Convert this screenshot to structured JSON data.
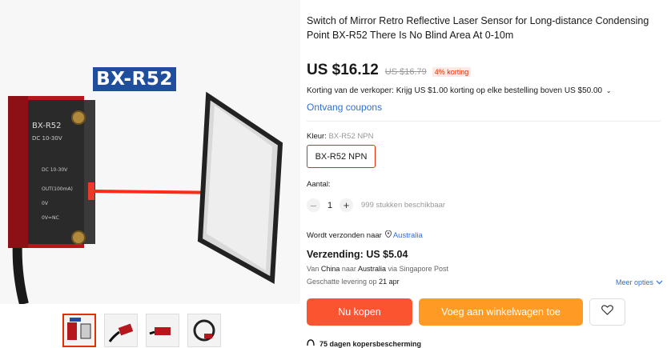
{
  "gallery": {
    "model_badge": "BX-R52",
    "sensor_label_lines": [
      "BX-R52",
      "DC 10-30V",
      "DC 10-30V",
      "OUT(100mA)",
      "0V",
      "0V=NC"
    ],
    "thumbnails": [
      {
        "name": "thumb-1",
        "active": true
      },
      {
        "name": "thumb-2",
        "active": false
      },
      {
        "name": "thumb-3",
        "active": false
      },
      {
        "name": "thumb-4",
        "active": false
      }
    ]
  },
  "product": {
    "title": "Switch of Mirror Retro Reflective Laser Sensor for Long-distance Condensing Point BX-R52 There Is No Blind Area At 0-10m",
    "price": "US $16.12",
    "original_price": "US $16.79",
    "discount": "4% korting",
    "seller_discount": "Korting van de verkoper: Krijg US $1.00 korting op elke bestelling boven US $50.00",
    "coupons": "Ontvang coupons"
  },
  "variant": {
    "color_label": "Kleur:",
    "color_value": "BX-R52 NPN",
    "selected": "BX-R52 NPN"
  },
  "quantity": {
    "label": "Aantal:",
    "minus": "–",
    "value": "1",
    "plus": "+",
    "stock": "999 stukken beschikbaar"
  },
  "shipping": {
    "ship_to_label": "Wordt verzonden naar",
    "country": "Australia",
    "cost": "Verzending: US $5.04",
    "from_label": "Van",
    "from": "China",
    "to_label": "naar",
    "to": "Australia",
    "via": "via Singapore Post",
    "eta_label": "Geschatte levering op",
    "eta_date": "21 apr",
    "more_options": "Meer opties"
  },
  "actions": {
    "buy_now": "Nu kopen",
    "add_to_cart": "Voeg aan winkelwagen toe"
  },
  "protection": {
    "text": "75 dagen kopersbescherming"
  },
  "colors": {
    "accent": "#e62e04",
    "buy_button": "#fb5431",
    "cart_button": "#ff9a24",
    "link": "#2f6fd6",
    "badge": "#1f4f9c"
  }
}
